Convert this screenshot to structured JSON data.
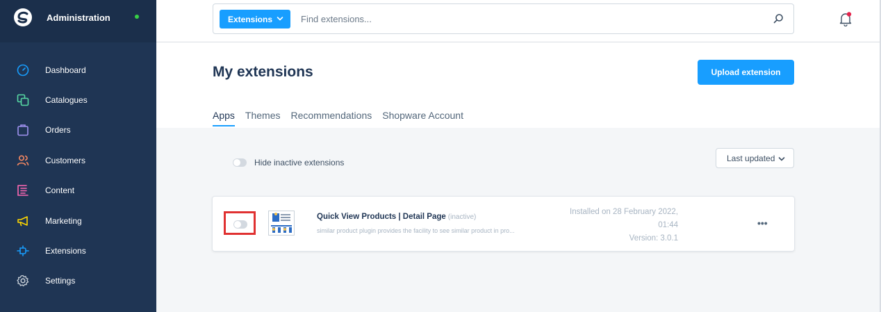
{
  "sidebar": {
    "title": "Administration",
    "items": [
      {
        "label": "Dashboard",
        "icon": "dashboard-icon",
        "color": "#189eff"
      },
      {
        "label": "Catalogues",
        "icon": "catalogues-icon",
        "color": "#57d9a3"
      },
      {
        "label": "Orders",
        "icon": "orders-icon",
        "color": "#a092f0"
      },
      {
        "label": "Customers",
        "icon": "customers-icon",
        "color": "#f88962"
      },
      {
        "label": "Content",
        "icon": "content-icon",
        "color": "#ff68b4"
      },
      {
        "label": "Marketing",
        "icon": "marketing-icon",
        "color": "#ffd700"
      },
      {
        "label": "Extensions",
        "icon": "extensions-icon",
        "color": "#189eff"
      },
      {
        "label": "Settings",
        "icon": "settings-icon",
        "color": "#9aa8b5"
      }
    ]
  },
  "search": {
    "type_label": "Extensions",
    "placeholder": "Find extensions..."
  },
  "page": {
    "title": "My extensions",
    "upload_label": "Upload extension",
    "tabs": [
      "Apps",
      "Themes",
      "Recommendations",
      "Shopware Account"
    ],
    "active_tab": "Apps"
  },
  "filters": {
    "hide_inactive_label": "Hide inactive extensions",
    "sort_label": "Last updated"
  },
  "extension": {
    "name": "Quick View Products | Detail Page",
    "state": "(inactive)",
    "description": "similar product plugin provides the facility to see similar product in pro...",
    "installed_line1": "Installed on 28 February 2022,",
    "installed_line2": "01:44",
    "version": "Version: 3.0.1",
    "more": "•••"
  },
  "colors": {
    "accent": "#189eff",
    "sidebar_bg": "#1f3554",
    "highlight_box": "#e03131",
    "status_online": "#37d046"
  }
}
